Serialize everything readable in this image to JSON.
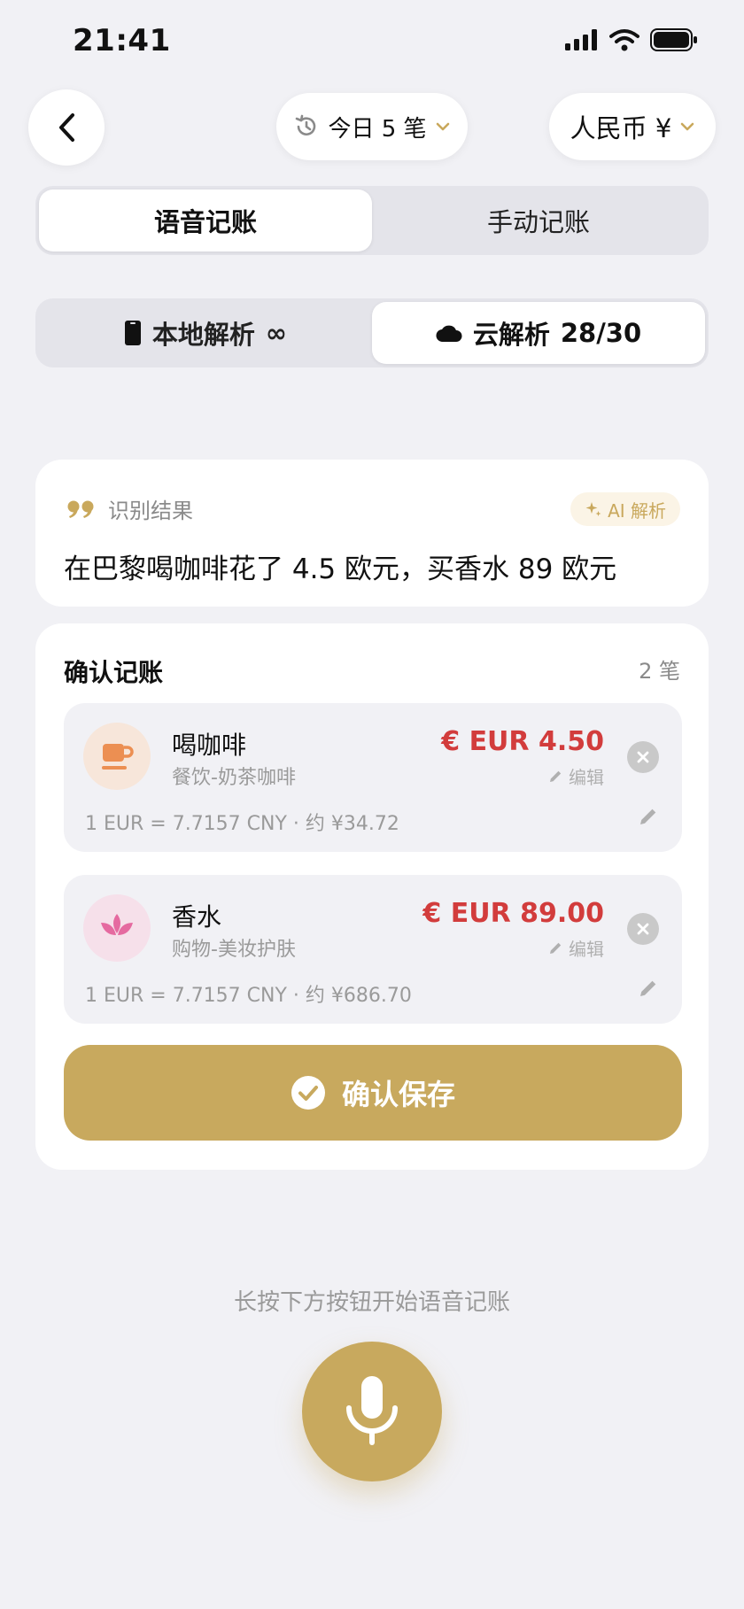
{
  "status_bar": {
    "time": "21:41"
  },
  "header": {
    "today_label": "今日 5 笔",
    "currency_label": "人民币 ¥"
  },
  "mode_tabs": [
    {
      "label": "语音记账",
      "active": true
    },
    {
      "label": "手动记账",
      "active": false
    }
  ],
  "parse_tabs": [
    {
      "label": "本地解析",
      "count": "∞",
      "active": false
    },
    {
      "label": "云解析",
      "count": "28/30",
      "active": true
    }
  ],
  "result": {
    "label": "识别结果",
    "badge": "AI 解析",
    "text": "在巴黎喝咖啡花了 4.5 欧元，买香水 89 欧元"
  },
  "confirm": {
    "title": "确认记账",
    "count": "2 笔",
    "edit_label": "编辑",
    "entries": [
      {
        "name": "喝咖啡",
        "category": "餐饮-奶茶咖啡",
        "amount": "€ EUR 4.50",
        "rate": "1 EUR = 7.7157 CNY · 约 ¥34.72",
        "icon": "coffee-cup-icon"
      },
      {
        "name": "香水",
        "category": "购物-美妆护肤",
        "amount": "€ EUR 89.00",
        "rate": "1 EUR = 7.7157 CNY · 约 ¥686.70",
        "icon": "lotus-icon"
      }
    ],
    "save_label": "确认保存"
  },
  "hint": "长按下方按钮开始语音记账",
  "colors": {
    "accent_gold": "#c8a95e",
    "amount_red": "#d23c3c",
    "background": "#f1f1f5"
  }
}
